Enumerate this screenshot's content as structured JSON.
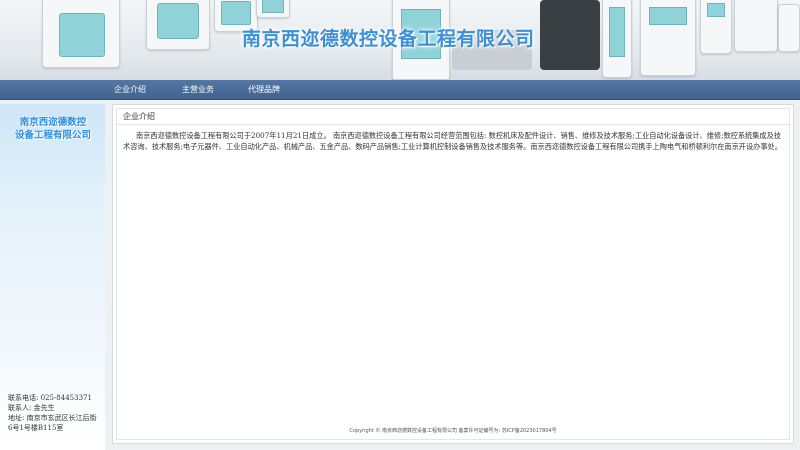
{
  "banner": {
    "title": "南京西迩德数控设备工程有限公司"
  },
  "nav": {
    "items": [
      {
        "label": "企业介绍"
      },
      {
        "label": "主营业务"
      },
      {
        "label": "代理品牌"
      }
    ]
  },
  "sidebar": {
    "logo_line1": "南京西迩德数控",
    "logo_line2": "设备工程有限公司",
    "contact": {
      "phone": "联系电话:  025-84453371",
      "person": "联系人:  金先生",
      "address1": "地址:  南京市玄武区长江后街",
      "address2": "6号1号楼B115室"
    }
  },
  "main": {
    "section_title": "企业介绍",
    "paragraph": "南京西迩德数控设备工程有限公司于2007年11月21日成立。 南京西迩德数控设备工程有限公司经营范围包括: 数控机床及配件设计、销售、维修及技术服务;工业自动化设备设计、维修;数控系统集成及技术咨询、技术服务;电子元器件、工业自动化产品、机械产品、五金产品、数码产品销售;工业计算机控制设备销售及技术服务等。南京西迩德数控设备工程有限公司携手上陶电气和桥顿利尔在南京开设办事处。",
    "footer": "Copyright © 南京西迩德数控设备工程有限公司 备案许可证编号为: 苏ICP备2023017804号"
  }
}
